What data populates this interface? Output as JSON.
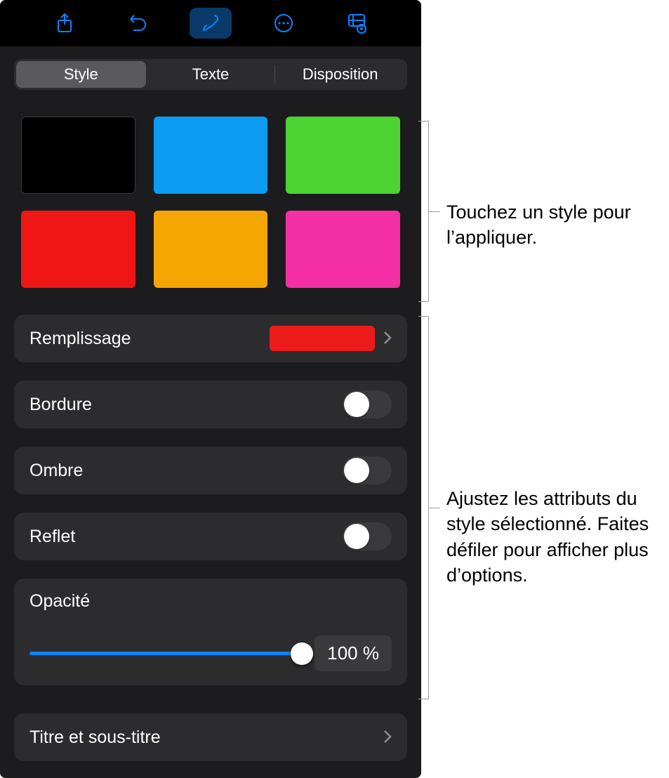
{
  "tabs": {
    "style": "Style",
    "text": "Texte",
    "layout": "Disposition"
  },
  "swatches": [
    {
      "color": "#000000"
    },
    {
      "color": "#0b9cf1"
    },
    {
      "color": "#4cd332"
    },
    {
      "color": "#f01616"
    },
    {
      "color": "#f5a602"
    },
    {
      "color": "#f52fa6"
    }
  ],
  "fill": {
    "label": "Remplissage",
    "color": "#ed1b1b"
  },
  "border": {
    "label": "Bordure"
  },
  "shadow": {
    "label": "Ombre"
  },
  "reflection": {
    "label": "Reflet"
  },
  "opacity": {
    "label": "Opacité",
    "value_text": "100 %"
  },
  "title_row": {
    "label": "Titre et sous-titre"
  },
  "callouts": {
    "swatches": "Touchez un style pour l’appliquer.",
    "attributes": "Ajustez les attributs du style sélectionné. Faites défiler pour afficher plus d’options."
  }
}
